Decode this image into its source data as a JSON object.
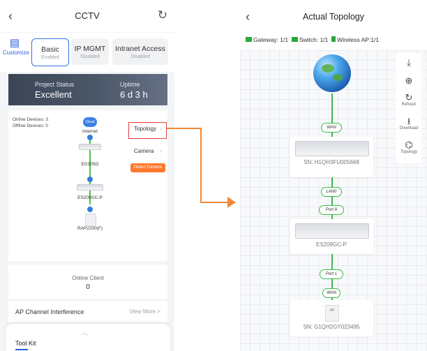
{
  "left": {
    "header": {
      "title": "CCTV",
      "back_icon": "‹",
      "refresh_icon": "↻"
    },
    "customize_label": "Customize",
    "tabs": [
      {
        "name": "Basic",
        "status": "Enabled"
      },
      {
        "name": "IP MGMT",
        "status": "Disabled"
      },
      {
        "name": "Intranet Access",
        "status": "Disabled"
      }
    ],
    "project_status": {
      "label": "Project Status",
      "value": "Excellent",
      "uptime_label": "Uptime",
      "uptime_value": "6 d 3 h"
    },
    "topology": {
      "online_devices": "Online Devices: 3",
      "offline_devices": "Offline Devices: 0",
      "cloud_label": "Cloud",
      "nodes": [
        "Internet",
        "EG105G",
        "ES209GC-P",
        "RAP2200(F)"
      ],
      "topology_button": "Topology",
      "camera_button": "Camera",
      "detect_camera": "Detect Camera"
    },
    "online_client": {
      "label": "Online Client",
      "value": "0"
    },
    "ap_channel": {
      "label": "AP Channel Interference",
      "more": "View More >"
    },
    "toolkit": {
      "label": "Tool Kit"
    }
  },
  "right": {
    "header": {
      "title": "Actual Topology",
      "back_icon": "‹"
    },
    "legend": {
      "gateway": "Gateway: 1/1",
      "switch": "Switch: 1/1",
      "ap": "Wireless AP:1/1"
    },
    "links": {
      "wan": "WAN",
      "lan0": "LAN0",
      "port9": "Port 9",
      "port1": "Port 1",
      "wan2": "WAN"
    },
    "gateway": {
      "sn": "SN:  H1QH3FU005668"
    },
    "switch": {
      "model": "ES209GC-P"
    },
    "ap": {
      "sn": "SN:  G1QH2GY023495",
      "badge": "AP"
    },
    "tools": [
      {
        "icon": "⤓",
        "label": ""
      },
      {
        "icon": "⊕",
        "label": ""
      },
      {
        "icon": "↻",
        "label": "Refresh"
      },
      {
        "icon": "⭳",
        "label": "Download"
      },
      {
        "icon": "⌬",
        "label": "Topology"
      }
    ]
  },
  "colors": {
    "accent": "#2b5fd9",
    "link_green": "#3cb84a",
    "arrow": "#f08a3a",
    "highlight_red": "#e03c3c",
    "detect_orange": "#ff7a2e"
  }
}
